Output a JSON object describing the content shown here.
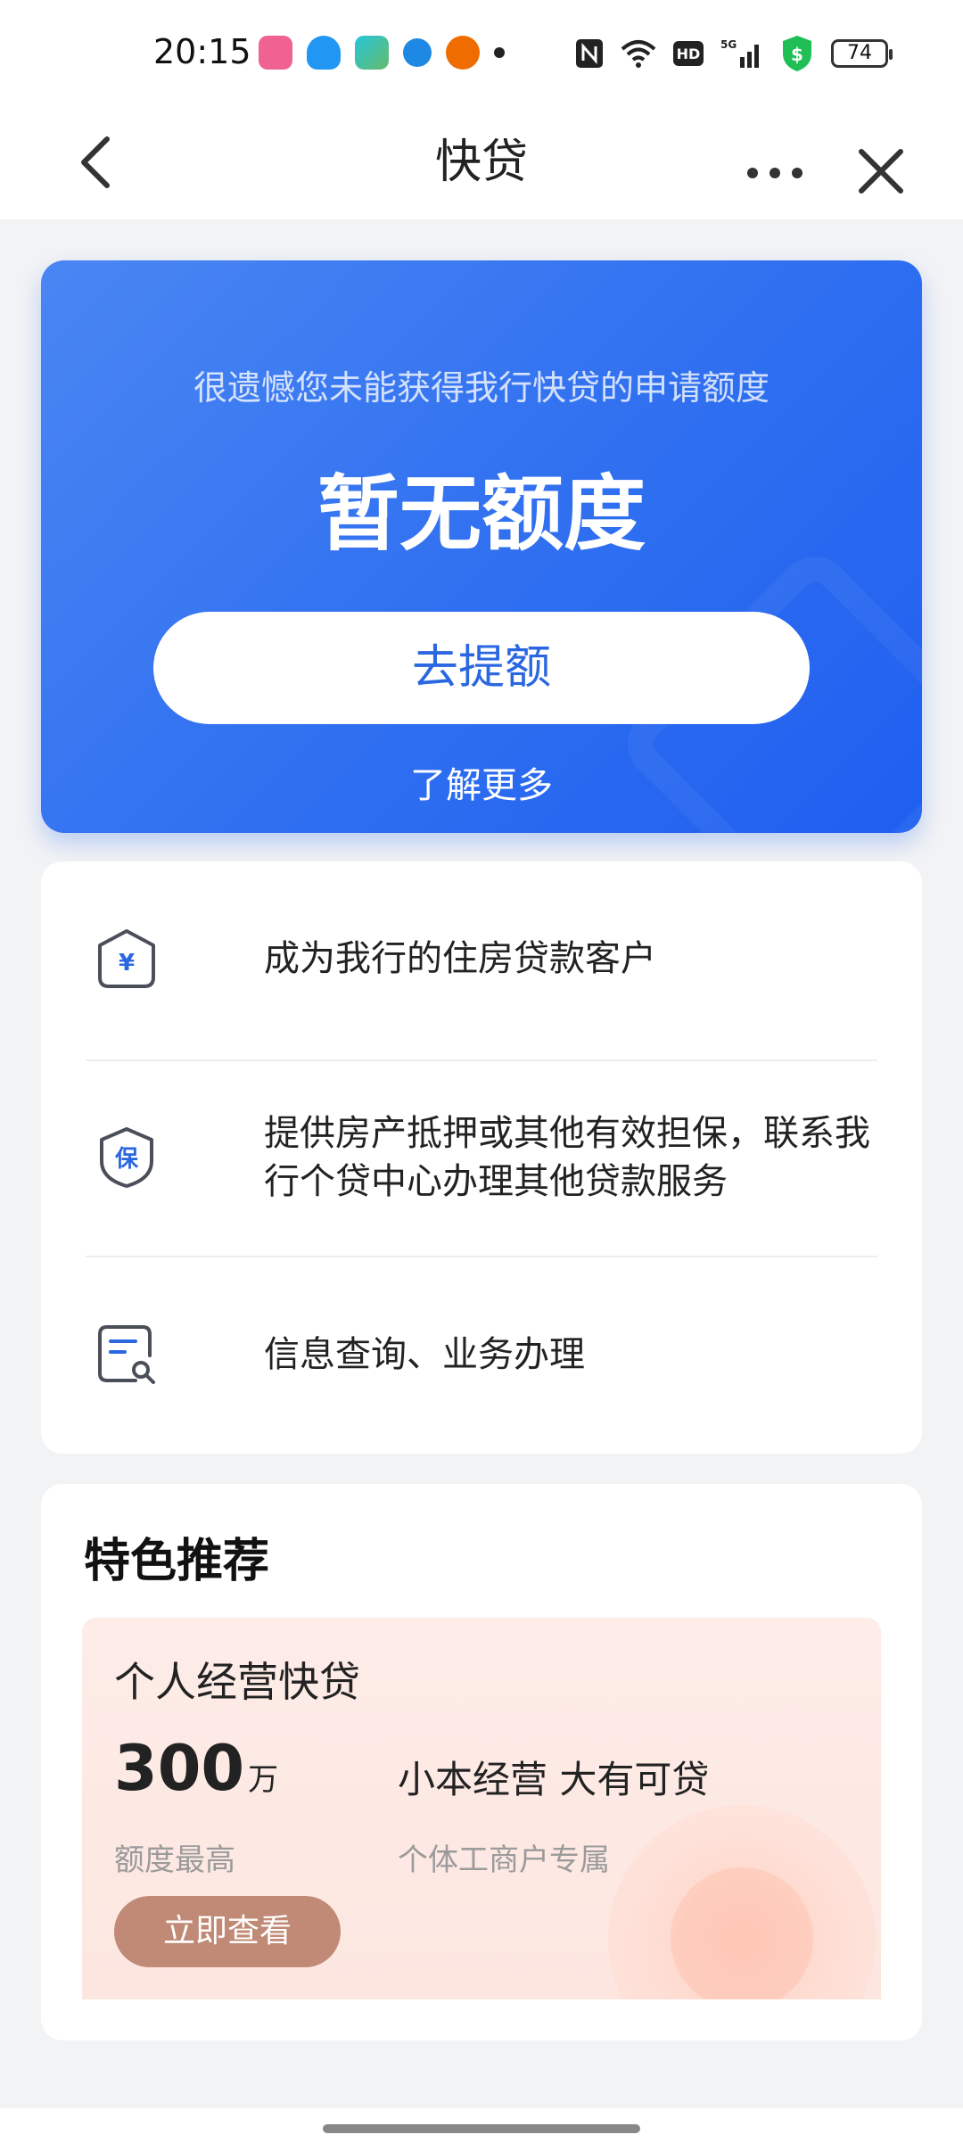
{
  "status_bar": {
    "time": "20:15",
    "battery": "74",
    "icons": [
      "bilibili-app-icon",
      "qq-icon",
      "tencent-video-icon",
      "browser-icon",
      "pumpkin-app-icon",
      "dot-icon",
      "nfc-icon",
      "wifi-icon",
      "hd-icon",
      "5g-signal-icon",
      "security-shield-icon",
      "battery-icon"
    ]
  },
  "header": {
    "title": "快贷"
  },
  "hero": {
    "subtitle": "很遗憾您未能获得我行快贷的申请额度",
    "title": "暂无额度",
    "button_label": "去提额",
    "link_label": "了解更多"
  },
  "options": [
    {
      "icon": "yuan-house-icon",
      "text": "成为我行的住房贷款客户"
    },
    {
      "icon": "guarantee-shield-icon",
      "text": "提供房产抵押或其他有效担保，联系我行个贷中心办理其他贷款服务"
    },
    {
      "icon": "document-search-icon",
      "text": "信息查询、业务办理"
    }
  ],
  "recommend": {
    "title": "特色推荐",
    "card": {
      "name": "个人经营快贷",
      "amount": "300",
      "unit": "万",
      "amount_label": "额度最高",
      "slogan": "小本经营 大有可贷",
      "slogan_sub": "个体工商户专属",
      "button_label": "立即查看"
    }
  },
  "colors": {
    "primary_blue": "#2f6ff0",
    "card_button": "#c08a76",
    "background": "#f2f3f5"
  }
}
